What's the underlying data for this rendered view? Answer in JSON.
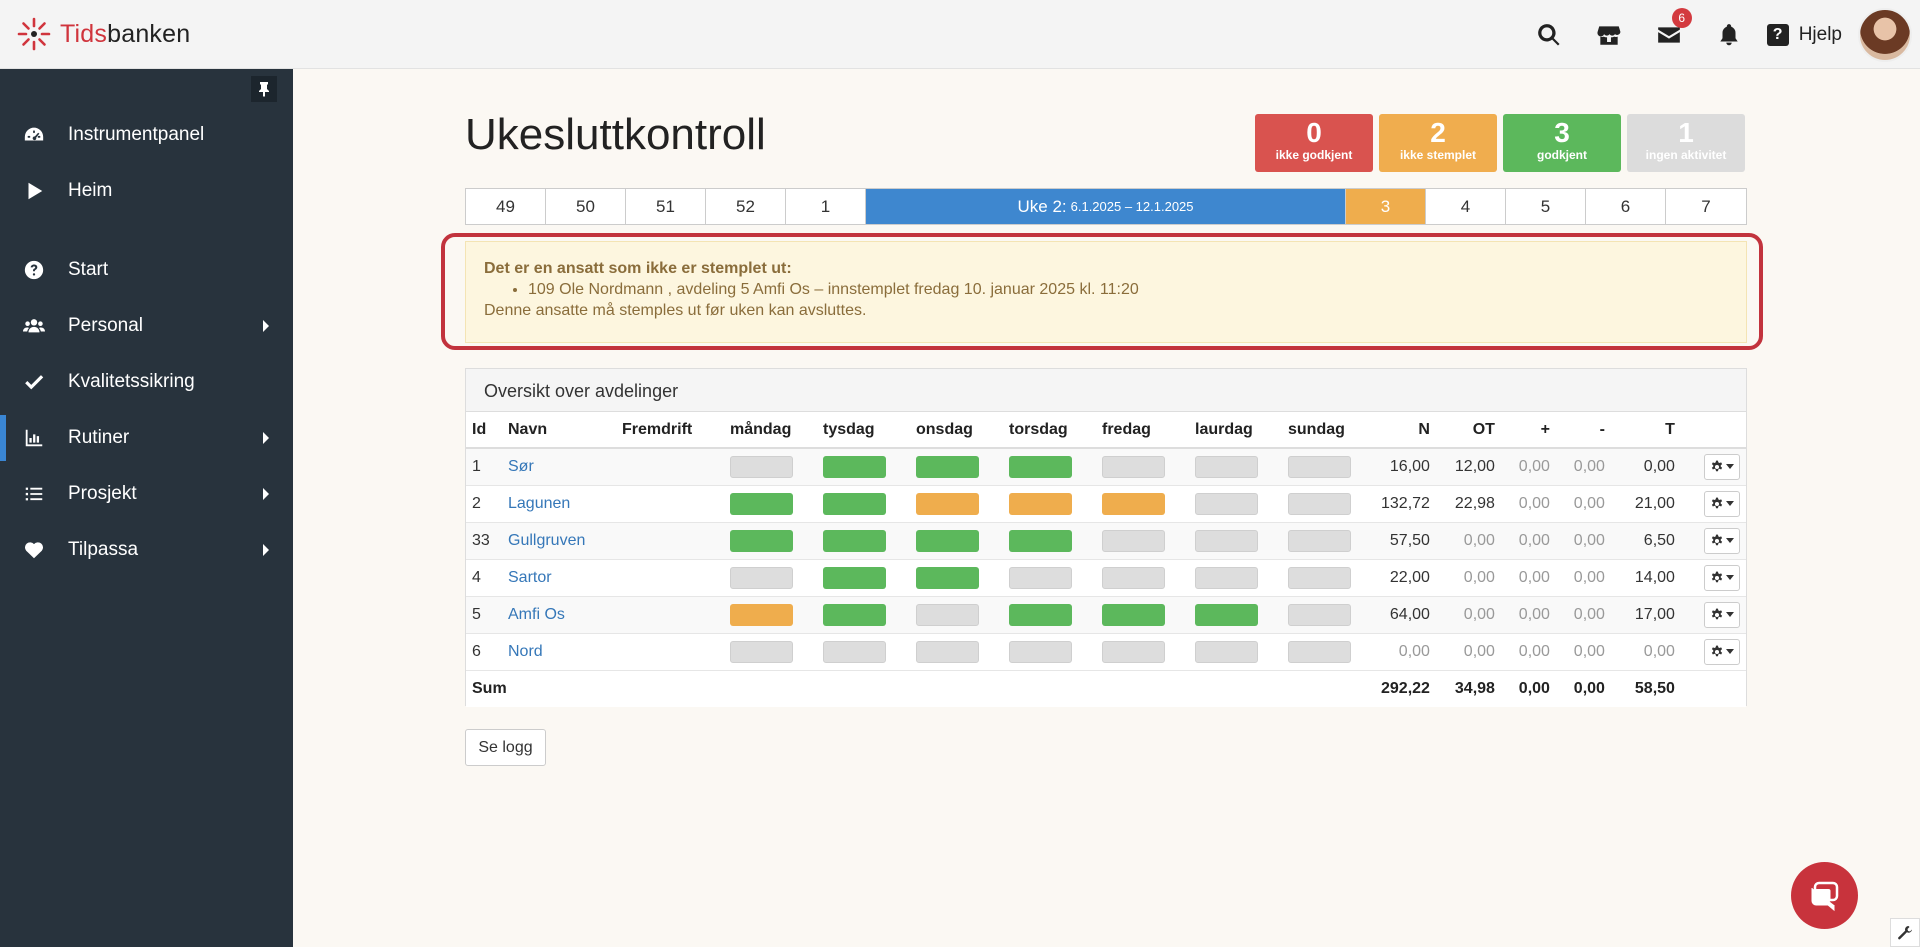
{
  "app": {
    "logo_red": "Tids",
    "logo_dark": "banken"
  },
  "header": {
    "mail_badge": "6",
    "help_label": "Hjelp",
    "help_mark": "?"
  },
  "sidebar": {
    "items": [
      {
        "label": "Instrumentpanel",
        "icon": "dashboard-icon"
      },
      {
        "label": "Heim",
        "icon": "play-icon"
      },
      {
        "label": "Start",
        "icon": "question-circle-icon"
      },
      {
        "label": "Personal",
        "icon": "users-icon"
      },
      {
        "label": "Kvalitetssikring",
        "icon": "check-icon"
      },
      {
        "label": "Rutiner",
        "icon": "bar-chart-icon"
      },
      {
        "label": "Prosjekt",
        "icon": "list-icon"
      },
      {
        "label": "Tilpassa",
        "icon": "heart-icon"
      }
    ]
  },
  "page": {
    "title": "Ukesluttkontroll"
  },
  "stats": [
    {
      "value": "0",
      "label": "ikke godkjent",
      "color": "#d9534f"
    },
    {
      "value": "2",
      "label": "ikke stemplet",
      "color": "#f0ad4e"
    },
    {
      "value": "3",
      "label": "godkjent",
      "color": "#5cb85c"
    },
    {
      "value": "1",
      "label": "ingen aktivitet",
      "color": "#dcdcdc"
    }
  ],
  "weeks": {
    "before": [
      "49",
      "50",
      "51",
      "52",
      "1"
    ],
    "current_label": "Uke 2:",
    "current_range": "6.1.2025 – 12.1.2025",
    "after": [
      "3",
      "4",
      "5",
      "6",
      "7"
    ]
  },
  "alert": {
    "heading": "Det er en ansatt som ikke er stemplet ut:",
    "item": "109 Ole Nordmann , avdeling 5 Amfi Os – innstemplet fredag 10. januar 2025 kl. 11:20",
    "footer": "Denne ansatte må stemples ut før uken kan avsluttes."
  },
  "overview": {
    "title": "Oversikt over avdelinger",
    "headers": {
      "id": "Id",
      "name": "Navn",
      "progress": "Fremdrift",
      "mon": "måndag",
      "tue": "tysdag",
      "wed": "onsdag",
      "thu": "torsdag",
      "fri": "fredag",
      "sat": "laurdag",
      "sun": "sundag",
      "n": "N",
      "ot": "OT",
      "plus": "+",
      "minus": "-",
      "t": "T"
    },
    "rows": [
      {
        "id": "1",
        "name": "Sør",
        "days": [
          "gray",
          "green",
          "green",
          "green",
          "gray",
          "gray",
          "gray"
        ],
        "n": "16,00",
        "ot": "12,00",
        "plus": "0,00",
        "minus": "0,00",
        "t": "0,00"
      },
      {
        "id": "2",
        "name": "Lagunen",
        "days": [
          "green",
          "green",
          "orange",
          "orange",
          "orange",
          "gray",
          "gray"
        ],
        "n": "132,72",
        "ot": "22,98",
        "plus": "0,00",
        "minus": "0,00",
        "t": "21,00"
      },
      {
        "id": "33",
        "name": "Gullgruven",
        "days": [
          "green",
          "green",
          "green",
          "green",
          "gray",
          "gray",
          "gray"
        ],
        "n": "57,50",
        "ot": "0,00",
        "plus": "0,00",
        "minus": "0,00",
        "t": "6,50"
      },
      {
        "id": "4",
        "name": "Sartor",
        "days": [
          "gray",
          "green",
          "green",
          "gray",
          "gray",
          "gray",
          "gray"
        ],
        "n": "22,00",
        "ot": "0,00",
        "plus": "0,00",
        "minus": "0,00",
        "t": "14,00"
      },
      {
        "id": "5",
        "name": "Amfi Os",
        "days": [
          "orange",
          "green",
          "gray",
          "green",
          "green",
          "green",
          "gray"
        ],
        "n": "64,00",
        "ot": "0,00",
        "plus": "0,00",
        "minus": "0,00",
        "t": "17,00"
      },
      {
        "id": "6",
        "name": "Nord",
        "days": [
          "gray",
          "gray",
          "gray",
          "gray",
          "gray",
          "gray",
          "gray"
        ],
        "n": "0,00",
        "ot": "0,00",
        "plus": "0,00",
        "minus": "0,00",
        "t": "0,00"
      }
    ],
    "sum": {
      "label": "Sum",
      "n": "292,22",
      "ot": "34,98",
      "plus": "0,00",
      "minus": "0,00",
      "t": "58,50"
    }
  },
  "buttons": {
    "log": "Se logg"
  }
}
